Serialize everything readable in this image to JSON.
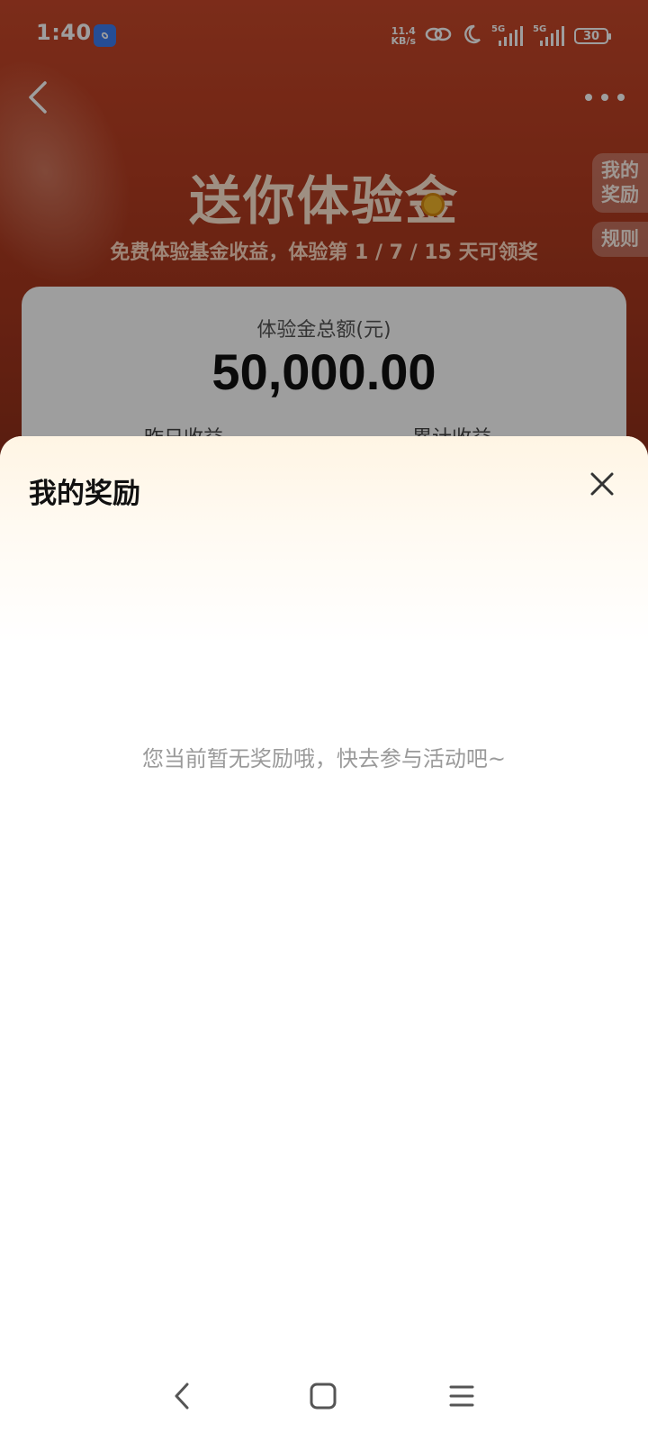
{
  "status_bar": {
    "time": "1:40",
    "net_speed_value": "11.4",
    "net_speed_unit": "KB/s",
    "signal1_label": "5G",
    "signal2_label": "5G",
    "battery": "30",
    "icons": [
      "app-link-icon",
      "hotspot-link-icon",
      "moon-icon",
      "signal-icon",
      "signal-icon",
      "battery-icon"
    ]
  },
  "header": {
    "back_icon": "chevron-left-icon",
    "more_icon": "more-dots-icon"
  },
  "hero": {
    "title": "送你体验金",
    "subtitle": "免费体验基金收益，体验第 1 / 7 / 15 天可领奖"
  },
  "side_tabs": {
    "rewards": "我的奖励",
    "rules": "规则"
  },
  "fund_card": {
    "label": "体验金总额(元)",
    "amount": "50,000.00",
    "yesterday_label": "昨日收益",
    "total_label": "累计收益"
  },
  "sheet": {
    "title": "我的奖励",
    "close_icon": "close-icon",
    "empty_message": "您当前暂无奖励哦，快去参与活动吧~"
  },
  "nav_bar": {
    "icons": [
      "nav-back-icon",
      "nav-home-icon",
      "nav-menu-icon"
    ]
  },
  "colors": {
    "hero_bg": "#c8482a",
    "sheet_top": "#fff5e4",
    "empty_text": "#9a9a9a"
  }
}
